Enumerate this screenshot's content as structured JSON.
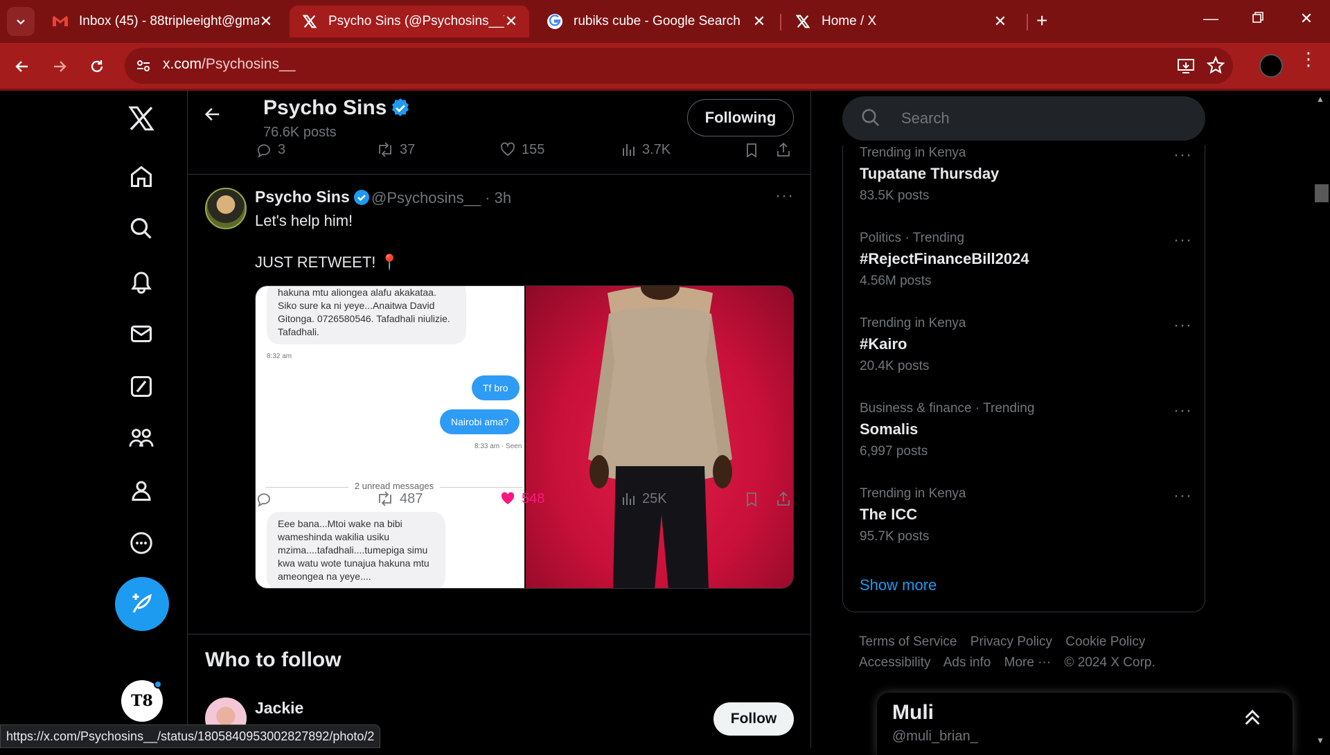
{
  "browser": {
    "tabs": [
      {
        "title": "Inbox (45) - 88tripleeight@gma",
        "icon": "gmail-icon"
      },
      {
        "title": "Psycho Sins (@Psychosins__) / X",
        "icon": "x-logo-icon",
        "active": true
      },
      {
        "title": "rubiks cube - Google Search",
        "icon": "google-icon"
      },
      {
        "title": "Home / X",
        "icon": "x-logo-icon"
      }
    ],
    "url_domain": "x.com",
    "url_path": "/Psychosins__",
    "status_url": "https://x.com/Psychosins__/status/1805840953002827892/photo/2",
    "theme_color": "#a51c1c"
  },
  "profile_header": {
    "name": "Psycho Sins",
    "posts": "76.6K posts",
    "following_label": "Following"
  },
  "prev_tweet_actions": {
    "replies": "3",
    "retweets": "37",
    "likes": "155",
    "views": "3.7K"
  },
  "tweet": {
    "author": "Psycho Sins",
    "handle_time": "@Psychosins__ · 3h",
    "line1": "Let's help him!",
    "line2": "JUST RETWEET! 📍",
    "retweets": "487",
    "likes": "548",
    "views": "25K",
    "like_color": "#f91880",
    "chat": {
      "msg1": "hakuna mtu aliongea alafu akakataa. Siko sure ka ni yeye...Anaitwa David Gitonga. 0726580546. Tafadhali niulizie. Tafadhali.",
      "time1": "8:32 am",
      "out1": "Tf bro",
      "out2": "Nairobi ama?",
      "time2": "8:33 am · Seen",
      "unread": "2 unread messages",
      "msg2": "Eee bana...Mtoi wake na bibi wameshinda wakilia usiku mzima....tafadhali....tumepiga simu kwa watu wote  tunajua hakuna mtu ameongea na yeye...."
    }
  },
  "who_to_follow": {
    "title": "Who to follow",
    "user": "Jackie",
    "follow_label": "Follow"
  },
  "sidebar": {
    "search_placeholder": "Search",
    "trends": [
      {
        "context": "Trending in Kenya",
        "name": "Tupatane Thursday",
        "count": "83.5K posts"
      },
      {
        "context": "Politics · Trending",
        "name": "#RejectFinanceBill2024",
        "count": "4.56M posts"
      },
      {
        "context": "Trending in Kenya",
        "name": "#Kairo",
        "count": "20.4K posts"
      },
      {
        "context": "Business & finance · Trending",
        "name": "Somalis",
        "count": "6,997 posts"
      },
      {
        "context": "Trending in Kenya",
        "name": "The ICC",
        "count": "95.7K posts"
      }
    ],
    "show_more": "Show more",
    "footer": [
      "Terms of Service",
      "Privacy Policy",
      "Cookie Policy",
      "Accessibility",
      "Ads info",
      "More ···",
      "© 2024 X Corp."
    ]
  },
  "messages_drawer": {
    "name": "Muli",
    "handle": "@muli_brian_"
  },
  "account_avatar_text": "T8",
  "accent_color": "#1d9bf0"
}
